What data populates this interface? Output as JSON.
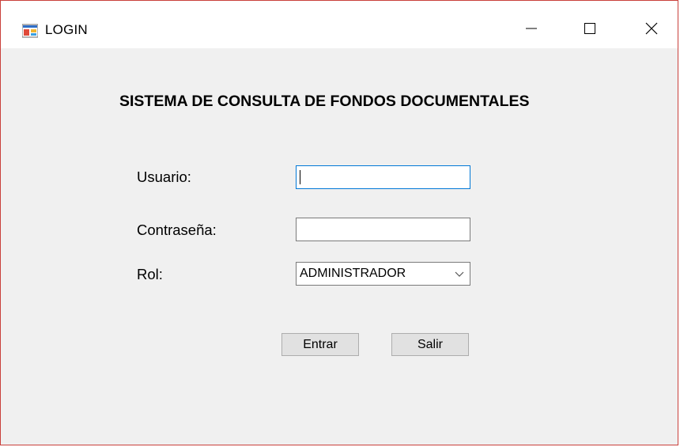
{
  "window": {
    "title": "LOGIN",
    "controls": [
      "minimize-icon",
      "maximize-icon",
      "close-icon"
    ]
  },
  "form": {
    "heading": "SISTEMA DE CONSULTA DE FONDOS DOCUMENTALES",
    "usuario_label": "Usuario:",
    "usuario_value": "",
    "contrasena_label": "Contraseña:",
    "contrasena_value": "",
    "rol_label": "Rol:",
    "rol_selected": "ADMINISTRADOR",
    "entrar_label": "Entrar",
    "salir_label": "Salir"
  },
  "colors": {
    "window_border": "#c9403b",
    "focus_border": "#0078d7",
    "background": "#f0f0f0",
    "button_bg": "#e1e1e1"
  }
}
